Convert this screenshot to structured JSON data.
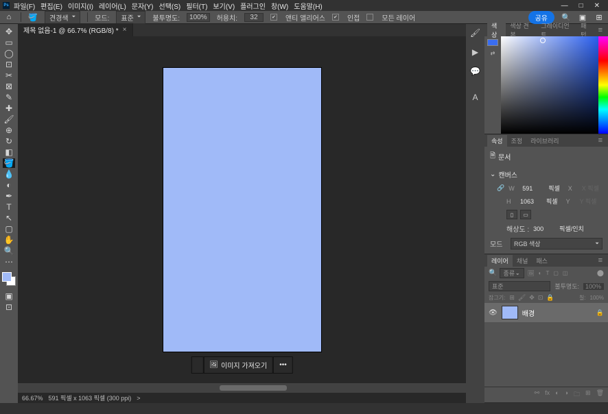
{
  "menu": {
    "file": "파일(F)",
    "edit": "편집(E)",
    "image": "이미지(I)",
    "layer": "레이어(L)",
    "type": "문자(Y)",
    "select": "선택(S)",
    "filter": "필터(T)",
    "view": "보기(V)",
    "plugin": "플러그인",
    "window": "창(W)",
    "help": "도움말(H)"
  },
  "win": {
    "min": "—",
    "max": "□",
    "close": "✕"
  },
  "options": {
    "swatch_label": "견경색",
    "mode_label": "모드:",
    "mode_value": "표준",
    "opacity_label": "불투명도:",
    "opacity_value": "100%",
    "tolerance_label": "허용치:",
    "tolerance_value": "32",
    "antialias": "앤티 앨리어스",
    "contiguous": "인접",
    "alllayers": "모든 레이어",
    "share": "공유"
  },
  "doc_tab": "제목 없음-1 @ 66.7% (RGB/8) *",
  "ctx": {
    "import": "이미지 가져오기",
    "more": "•••"
  },
  "status": {
    "zoom": "66.67%",
    "info": "591 픽셀 x 1063 픽셀 (300 ppi)",
    "arrow": ">"
  },
  "color_tabs": {
    "t1": "색상",
    "t2": "색상 견본",
    "t3": "그레이디언트",
    "t4": "패턴"
  },
  "props_tabs": {
    "t1": "속성",
    "t2": "조정",
    "t3": "라이브러리"
  },
  "props": {
    "doc": "문서",
    "canvas": "캔버스",
    "w": "W",
    "wval": "591",
    "h": "H",
    "hval": "1063",
    "unit": "픽셀",
    "x": "X",
    "y": "Y",
    "res": "해상도 :",
    "resval": "300",
    "resunit": "픽셀/인치",
    "mode": "모드",
    "modeval": "RGB 색상",
    "xph": "X 픽셀",
    "yph": "Y 픽셀"
  },
  "layers_tabs": {
    "t1": "레이어",
    "t2": "채널",
    "t3": "패스"
  },
  "layers": {
    "kind": "종류",
    "blend": "표준",
    "opacity_label": "불투명도:",
    "opacity": "100%",
    "lock": "잠그기:",
    "fill_label": "칠:",
    "fill": "100%",
    "bg": "배경"
  }
}
